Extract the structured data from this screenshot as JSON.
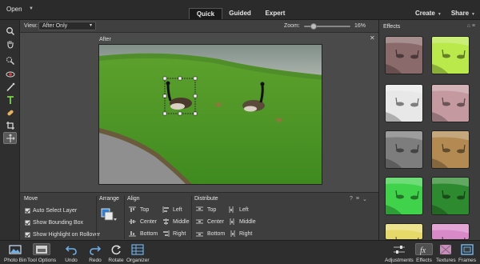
{
  "topbar": {
    "open_label": "Open",
    "modes": [
      "Quick",
      "Guided",
      "Expert"
    ],
    "create_label": "Create",
    "share_label": "Share"
  },
  "viewbar": {
    "view_label": "View:",
    "view_value": "After Only",
    "zoom_label": "Zoom:",
    "zoom_value": "16%",
    "zoom_level": 0.16
  },
  "canvas": {
    "after_label": "After"
  },
  "tools": [
    "zoom-icon",
    "hand-icon",
    "quick-selection-icon",
    "red-eye-icon",
    "whiten-teeth-icon",
    "type-icon",
    "spot-healing-icon",
    "crop-icon",
    "move-icon"
  ],
  "options": {
    "move": {
      "title": "Move",
      "checks": [
        "Auto Select Layer",
        "Show Bounding Box",
        "Show Highlight on Rollover"
      ]
    },
    "arrange_title": "Arrange",
    "align": {
      "title": "Align",
      "col1": [
        "Top",
        "Center",
        "Bottom"
      ],
      "col2": [
        "Left",
        "Middle",
        "Right"
      ]
    },
    "distribute": {
      "title": "Distribute",
      "col1": [
        "Top",
        "Center",
        "Bottom"
      ],
      "col2": [
        "Left",
        "Middle",
        "Right"
      ]
    }
  },
  "bottombar": {
    "left": [
      {
        "label": "Photo Bin",
        "icon": "photo-bin-icon"
      },
      {
        "label": "Tool Options",
        "icon": "tool-options-icon"
      },
      {
        "label": "Undo",
        "icon": "undo-icon"
      },
      {
        "label": "Redo",
        "icon": "redo-icon"
      },
      {
        "label": "Rotate",
        "icon": "rotate-icon"
      },
      {
        "label": "Organizer",
        "icon": "organizer-icon"
      }
    ],
    "right": [
      {
        "label": "Adjustments",
        "icon": "adjustments-icon"
      },
      {
        "label": "Effects",
        "icon": "effects-icon"
      },
      {
        "label": "Textures",
        "icon": "textures-icon"
      },
      {
        "label": "Frames",
        "icon": "frames-icon"
      }
    ]
  },
  "effects": {
    "title": "Effects",
    "thumbs": [
      {
        "name": "sepia-rose",
        "tint": "#8a6a6a"
      },
      {
        "name": "lime-glow",
        "tint": "#b9e94a"
      },
      {
        "name": "high-key",
        "tint": "#e8e8e8"
      },
      {
        "name": "pink-wash",
        "tint": "#c49aa0"
      },
      {
        "name": "monochrome",
        "tint": "#7d7d7d"
      },
      {
        "name": "warm-sepia",
        "tint": "#b28a52"
      },
      {
        "name": "vivid-green",
        "tint": "#3fd24a"
      },
      {
        "name": "deep-green",
        "tint": "#2e8a2e"
      },
      {
        "name": "yellow-fade",
        "tint": "#e7d86a"
      },
      {
        "name": "magenta-fade",
        "tint": "#d889c8"
      }
    ]
  },
  "colors": {
    "panel": "#3d3d3d",
    "accent": "#2a82da"
  }
}
